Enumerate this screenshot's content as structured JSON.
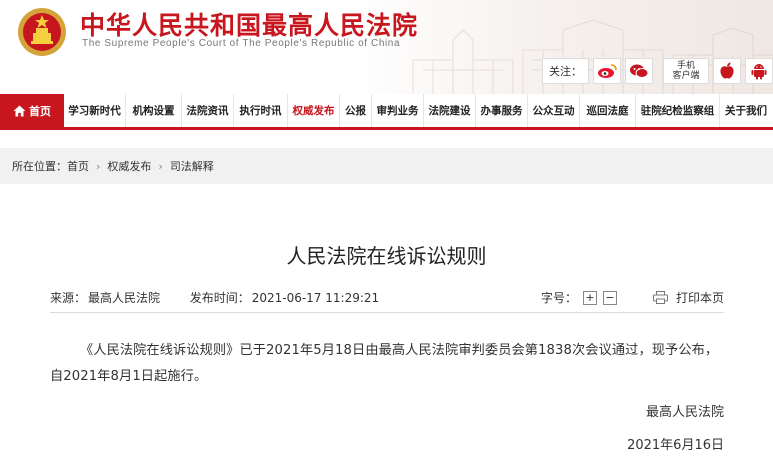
{
  "header": {
    "title": "中华人民共和国最高人民法院",
    "subtitle": "The Supreme People's Court of The People's Republic of China",
    "follow_label": "关注：",
    "mobile_client_line1": "手机",
    "mobile_client_line2": "客户端"
  },
  "nav": {
    "home": "首页",
    "items": [
      "学习新时代",
      "机构设置",
      "法院资讯",
      "执行时讯",
      "权威发布",
      "公报",
      "审判业务",
      "法院建设",
      "办事服务",
      "公众互动",
      "巡回法庭",
      "驻院纪检监察组",
      "关于我们"
    ],
    "active_index": 4
  },
  "breadcrumb": {
    "prefix": "所在位置：",
    "items": [
      "首页",
      "权威发布",
      "司法解释"
    ]
  },
  "article": {
    "title": "人民法院在线诉讼规则",
    "source_label": "来源：",
    "source": "最高人民法院",
    "time_label": "发布时间：",
    "time": "2021-06-17 11:29:21",
    "font_size_label": "字号：",
    "font_plus": "+",
    "font_minus": "−",
    "print_label": "打印本页",
    "body": "《人民法院在线诉讼规则》已于2021年5月18日由最高人民法院审判委员会第1838次会议通过，现予公布，自2021年8月1日起施行。",
    "signature_org": "最高人民法院",
    "signature_date": "2021年6月16日"
  },
  "colors": {
    "brand_red": "#c8161e",
    "breadcrumb_bg": "#f1f1f1"
  }
}
